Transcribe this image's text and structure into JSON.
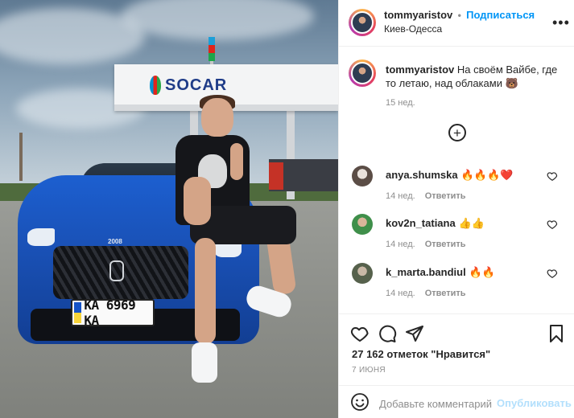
{
  "post": {
    "photo": {
      "station_sign": "SOCAR",
      "car_badge": "2008",
      "license_plate": "KA 6969 KA"
    },
    "header": {
      "username": "tommyaristov",
      "separator": "•",
      "follow_label": "Подписаться",
      "location": "Киев-Одесса",
      "more_label": "•••"
    },
    "caption": {
      "username": "tommyaristov",
      "text": "На своём Вайбе, где то летаю, над облаками 🐻",
      "time": "15 нед."
    },
    "load_more_label": "+",
    "comments": [
      {
        "username": "anya.shumska",
        "text": "🔥🔥🔥❤️",
        "time": "14 нед.",
        "reply_label": "Ответить"
      },
      {
        "username": "kov2n_tatiana",
        "text": "👍👍",
        "time": "14 нед.",
        "reply_label": "Ответить"
      },
      {
        "username": "k_marta.bandiul",
        "text": "🔥🔥",
        "time": "14 нед.",
        "reply_label": "Ответить"
      }
    ],
    "likes": "27 162 отметок \"Нравится\"",
    "date": "7 ИЮНЯ",
    "add_comment": {
      "placeholder": "Добавьте комментарий...",
      "publish_label": "Опубликовать"
    }
  },
  "colors": {
    "link_blue": "#0095f6",
    "publish_disabled": "#b2dffc",
    "meta_gray": "#8e8e8e",
    "text": "#262626"
  }
}
